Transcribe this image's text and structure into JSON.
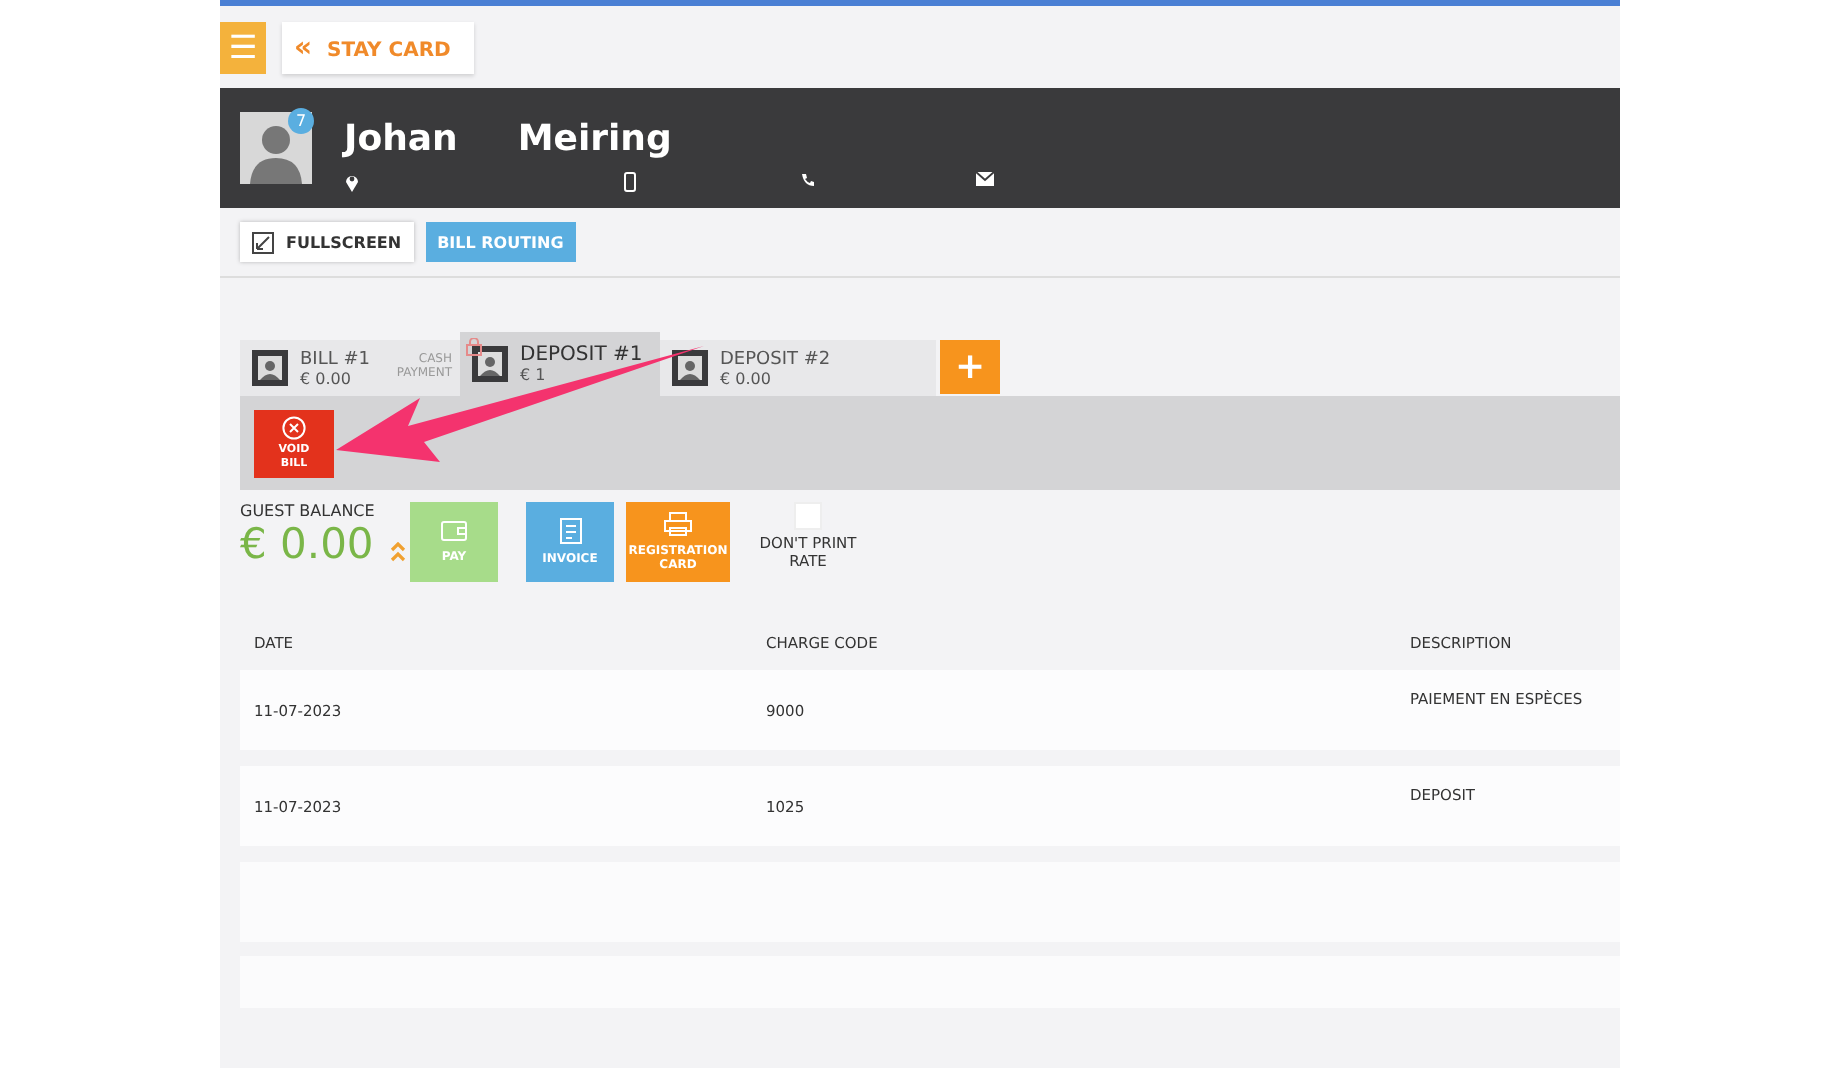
{
  "top_bar": {
    "menu_icon": "☰",
    "back_button": {
      "icon": "«",
      "label": "STAY CARD"
    }
  },
  "guest": {
    "badge": "7",
    "first_name": "Johan",
    "last_name": "Meiring"
  },
  "toolbar": {
    "buttons": [
      {
        "label": "FULLSCREEN",
        "kind": "plain"
      },
      {
        "label": "BILL ROUTING",
        "kind": "blue"
      }
    ]
  },
  "bill_tabs": [
    {
      "title": "BILL #1",
      "amount": "€ 0.00",
      "note": "CASH PAYMENT",
      "selected": false,
      "locked": false
    },
    {
      "title": "DEPOSIT #1",
      "amount": "€ 1",
      "selected": true,
      "locked": true
    },
    {
      "title": "DEPOSIT #2",
      "amount": "€ 0.00",
      "selected": false,
      "locked": false
    }
  ],
  "add_bill": "+",
  "void_bill": "VOID BILL",
  "balance": {
    "label": "GUEST BALANCE",
    "amount": "€ 0.00"
  },
  "actions": [
    {
      "label": "PAY",
      "kind": "pay"
    },
    {
      "label": "INVOICE",
      "kind": "invoice"
    },
    {
      "label": "REGISTRATION CARD",
      "kind": "registration"
    }
  ],
  "dont_print_rate": {
    "label": "DON'T PRINT RATE",
    "checked": false
  },
  "table": {
    "columns": [
      "DATE",
      "CHARGE CODE",
      "DESCRIPTION"
    ],
    "rows": [
      [
        "11-07-2023",
        "9000",
        "PAIEMENT EN ESPÈCES"
      ],
      [
        "11-07-2023",
        "1025",
        "DEPOSIT"
      ]
    ]
  }
}
